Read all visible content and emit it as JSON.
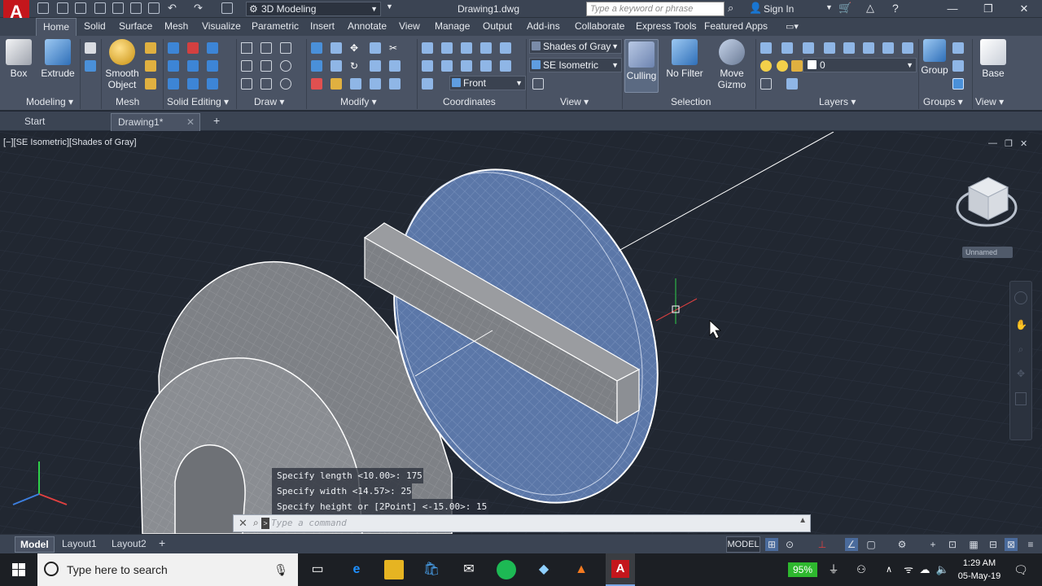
{
  "titlebar": {
    "workspace": "3D Modeling",
    "doc_title": "Drawing1.dwg",
    "search_placeholder": "Type a keyword or phrase",
    "signin": "Sign In"
  },
  "ribbon_tabs": [
    "Home",
    "Solid",
    "Surface",
    "Mesh",
    "Visualize",
    "Parametric",
    "Insert",
    "Annotate",
    "View",
    "Manage",
    "Output",
    "Add-ins",
    "Collaborate",
    "Express Tools",
    "Featured Apps"
  ],
  "ribbon": {
    "box": "Box",
    "extrude": "Extrude",
    "smooth1": "Smooth",
    "smooth2": "Object",
    "visual_style": "Shades of Gray",
    "view_preset": "SE Isometric",
    "named_view": "Front",
    "culling": "Culling",
    "nofilter": "No Filter",
    "move1": "Move",
    "move2": "Gizmo",
    "layer_value": "0",
    "group": "Group",
    "base": "Base",
    "panels": {
      "modeling": "Modeling",
      "mesh": "Mesh",
      "solid_editing": "Solid Editing",
      "draw": "Draw",
      "modify": "Modify",
      "coordinates": "Coordinates",
      "view": "View",
      "selection": "Selection",
      "layers": "Layers",
      "groups": "Groups",
      "view2": "View"
    }
  },
  "file_tabs": {
    "start": "Start",
    "drawing": "Drawing1*"
  },
  "viewport": {
    "label": "[−][SE Isometric][Shades of Gray]",
    "viewcube_name": "Unnamed"
  },
  "command": {
    "history": [
      "Specify length <10.00>: 175",
      "Specify width <14.57>: 25",
      "Specify height or [2Point] <-15.00>: 15"
    ],
    "prompt": "Type a command"
  },
  "layout_tabs": [
    "Model",
    "Layout1",
    "Layout2"
  ],
  "status": {
    "model": "MODEL"
  },
  "taskbar": {
    "search": "Type here to search",
    "battery": "95%",
    "time": "1:29 AM",
    "date": "05-May-19"
  },
  "colors": {
    "accent_blue": "#4d6fa8",
    "autocad_red": "#c4161c",
    "ribbon_bg": "#4a5364"
  }
}
